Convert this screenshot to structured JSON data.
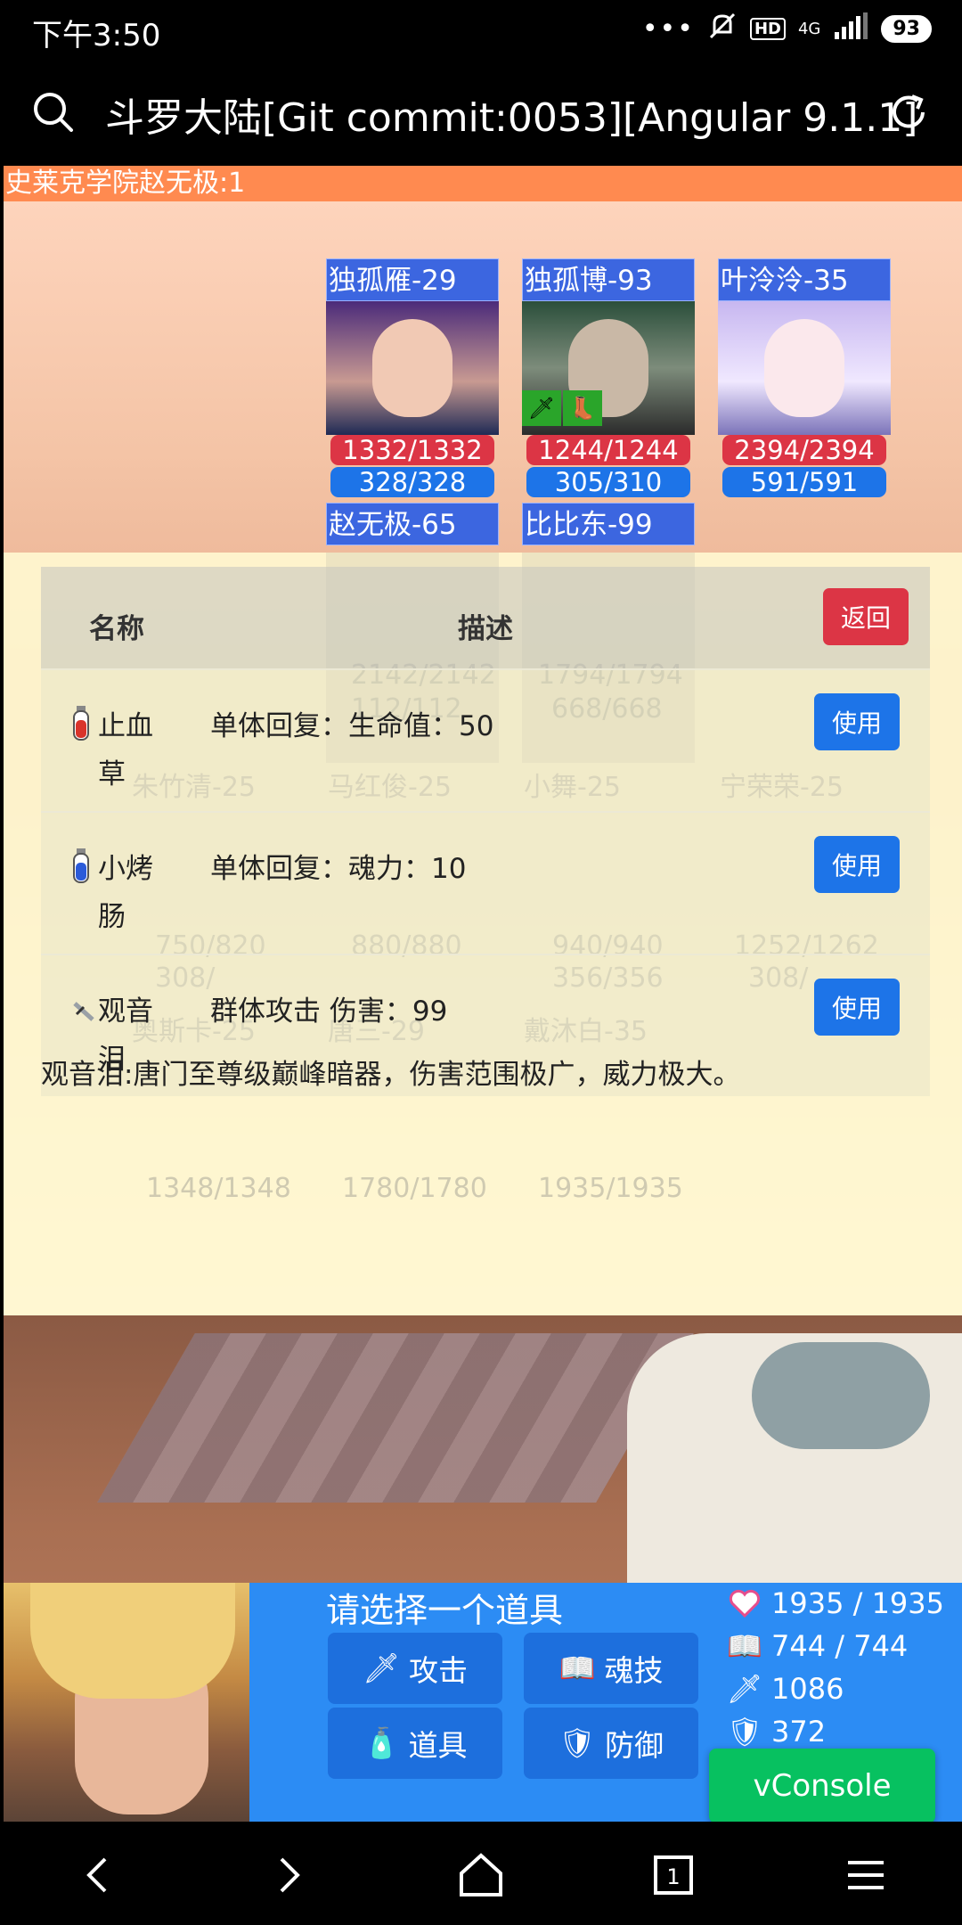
{
  "status": {
    "time": "下午3:50",
    "network": "4G",
    "hd": "HD",
    "battery": "93"
  },
  "browser": {
    "title": "斗罗大陆[Git commit:0053][Angular 9.1.1]"
  },
  "page": {
    "title": "史莱克学院赵无极:1"
  },
  "enemies": [
    {
      "name": "独孤雁-29",
      "hp": "1332/1332",
      "mp": "328/328"
    },
    {
      "name": "独孤博-93",
      "hp": "1244/1244",
      "mp": "305/310"
    },
    {
      "name": "叶泠泠-35",
      "hp": "2394/2394",
      "mp": "591/591"
    },
    {
      "name": "赵无极-65"
    },
    {
      "name": "比比东-99"
    }
  ],
  "ghost": {
    "values": [
      "2142/2142",
      "1794/1794",
      "112/112",
      "668/668"
    ],
    "names_row2": [
      "朱竹清-25",
      "马红俊-25",
      "小舞-25",
      "宁荣荣-25"
    ],
    "values_row2": [
      "750/820",
      "880/880",
      "940/940",
      "1252/1262",
      "308/",
      "356/356",
      "308/"
    ],
    "names_row3": [
      "奥斯卡-25",
      "唐三-29",
      "戴沐白-35"
    ],
    "values_row3": [
      "1348/1348",
      "1780/1780",
      "1935/1935"
    ]
  },
  "items_table": {
    "col_name": "名称",
    "col_desc": "描述",
    "back_label": "返回",
    "use_label": "使用",
    "rows": [
      {
        "name": "止血草",
        "desc": "单体回复：生命值：50",
        "icon": "red-potion-icon"
      },
      {
        "name": "小烤肠",
        "desc": "单体回复：魂力：10",
        "icon": "blue-potion-icon"
      },
      {
        "name": "观音泪",
        "desc": "群体攻击 伤害：99",
        "icon": "dagger-icon"
      }
    ],
    "selected_description": "观音泪:唐门至尊级巅峰暗器，伤害范围极广，威力极大。"
  },
  "panel": {
    "prompt": "请选择一个道具",
    "actions": {
      "attack": "攻击",
      "skill": "魂技",
      "item": "道具",
      "defend": "防御"
    },
    "stats": {
      "hp": "1935 / 1935",
      "mp": "744 / 744",
      "atk": "1086",
      "def": "372"
    }
  },
  "vconsole": "vConsole",
  "colors": {
    "hp_red": "#dc3545",
    "mp_blue": "#1d74e8",
    "panel_blue": "#2c8cf4",
    "vconsole_green": "#07c160",
    "header_orange": "#ff8a50"
  }
}
